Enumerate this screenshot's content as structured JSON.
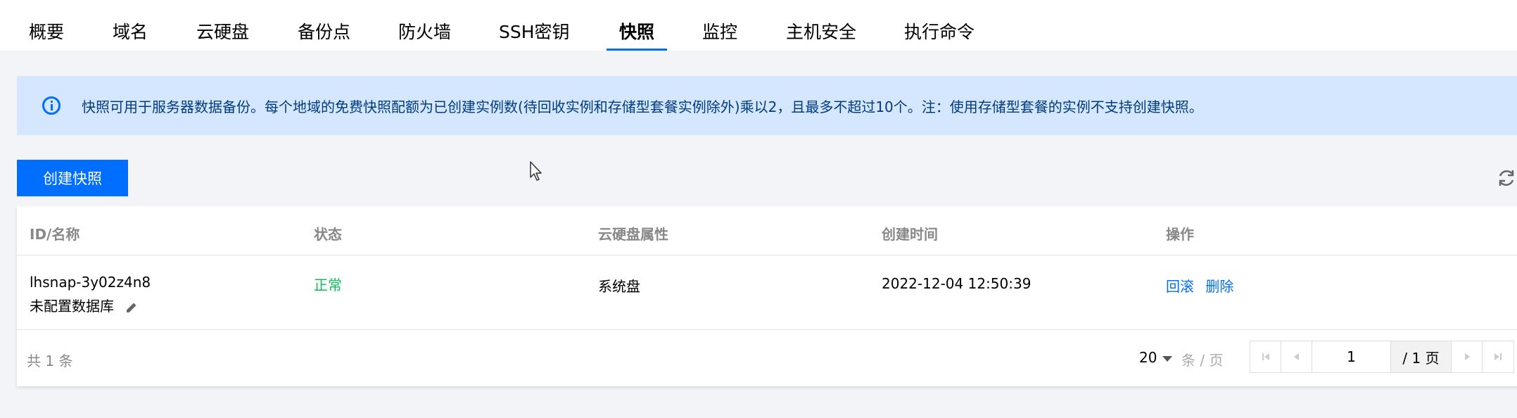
{
  "tabs": [
    {
      "label": "概要"
    },
    {
      "label": "域名"
    },
    {
      "label": "云硬盘"
    },
    {
      "label": "备份点"
    },
    {
      "label": "防火墙"
    },
    {
      "label": "SSH密钥"
    },
    {
      "label": "快照",
      "active": true
    },
    {
      "label": "监控"
    },
    {
      "label": "主机安全"
    },
    {
      "label": "执行命令"
    }
  ],
  "alert": {
    "text": "快照可用于服务器数据备份。每个地域的免费快照配额为已创建实例数(待回收实例和存储型套餐实例除外)乘以2，且最多不超过10个。注：使用存储型套餐的实例不支持创建快照。"
  },
  "toolbar": {
    "create_label": "创建快照"
  },
  "table": {
    "headers": [
      "ID/名称",
      "状态",
      "云硬盘属性",
      "创建时间",
      "操作"
    ],
    "rows": [
      {
        "id": "lhsnap-3y02z4n8",
        "name": "未配置数据库",
        "status": "正常",
        "disk_type": "系统盘",
        "created": "2022-12-04 12:50:39",
        "actions": [
          "回滚",
          "删除"
        ]
      }
    ]
  },
  "footer": {
    "total": "共  1  条",
    "page_size": "20",
    "per_page_label": "条 / 页",
    "current_page": "1",
    "total_pages": "/ 1 页"
  },
  "colors": {
    "accent": "#006eff",
    "success": "#0abf5b",
    "alert_bg": "#d5e7ff"
  }
}
